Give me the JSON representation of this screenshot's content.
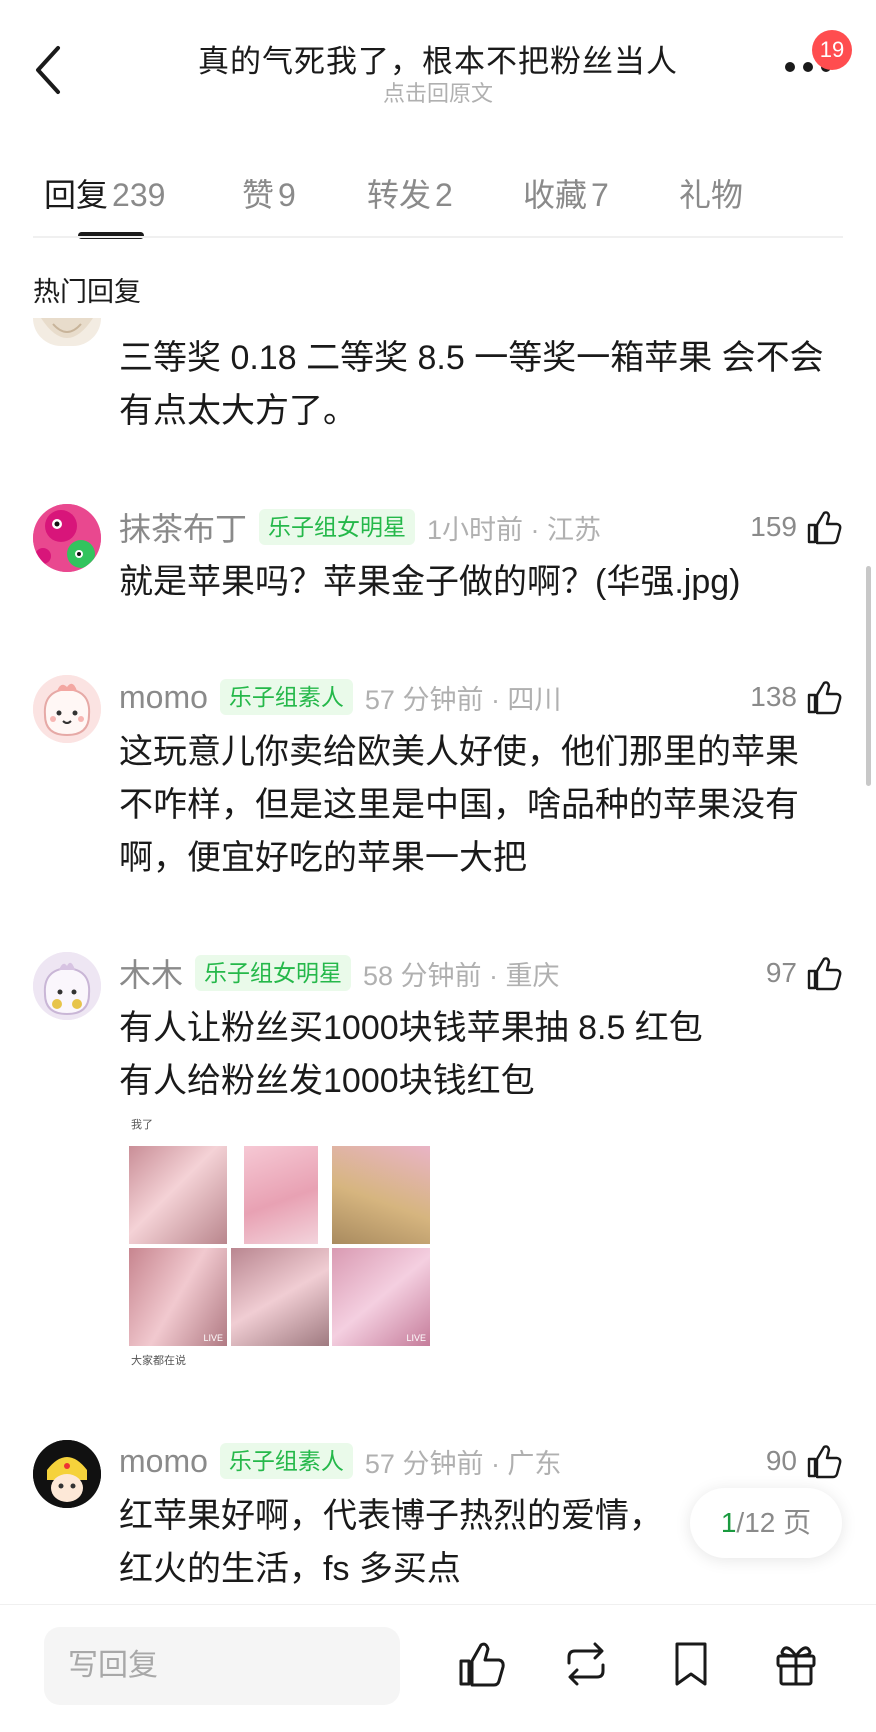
{
  "header": {
    "title": "真的气死我了，根本不把粉丝当人",
    "subtitle": "点击回原文",
    "notification_count": "19"
  },
  "tabs": [
    {
      "label": "回复",
      "count": "239",
      "active": true
    },
    {
      "label": "赞",
      "count": "9",
      "active": false
    },
    {
      "label": "转发",
      "count": "2",
      "active": false
    },
    {
      "label": "收藏",
      "count": "7",
      "active": false
    },
    {
      "label": "礼物",
      "count": "",
      "active": false
    }
  ],
  "section_label": "热门回复",
  "comments": [
    {
      "text_lines": [
        "三等奖 0.18 二等奖 8.5 一等奖一箱苹果 会不会",
        "有点太大方了。"
      ]
    },
    {
      "username": "抹茶布丁",
      "tag": "乐子组女明星",
      "time": "1小时前 · 江苏",
      "likes": "159",
      "text_lines": [
        "就是苹果吗？苹果金子做的啊？(华强.jpg)"
      ]
    },
    {
      "username": "momo",
      "tag": "乐子组素人",
      "time": "57 分钟前 · 四川",
      "likes": "138",
      "text_lines": [
        "这玩意儿你卖给欧美人好使，他们那里的苹果",
        "不咋样，但是这里是中国，啥品种的苹果没有",
        "啊，便宜好吃的苹果一大把"
      ]
    },
    {
      "username": "木木",
      "tag": "乐子组女明星",
      "time": "58 分钟前 · 重庆",
      "likes": "97",
      "text_lines": [
        "有人让粉丝买1000块钱苹果抽 8.5 红包",
        "有人给粉丝发1000块钱红包"
      ],
      "image_caption_top": "我了",
      "image_caption_bottom": "大家都在说",
      "live_label": "LIVE"
    },
    {
      "username": "momo",
      "tag": "乐子组素人",
      "time": "57 分钟前 · 广东",
      "likes": "90",
      "text_lines": [
        "红苹果好啊，代表博子热烈的爱情，",
        "红火的生活，fs 多买点"
      ]
    }
  ],
  "pagination": {
    "current": "1",
    "total": "/12 页"
  },
  "bottom_bar": {
    "reply_placeholder": "写回复"
  },
  "colors": {
    "accent_green": "#25b84a",
    "tag_bg": "#eafaea",
    "badge_red": "#ff4d4f"
  }
}
